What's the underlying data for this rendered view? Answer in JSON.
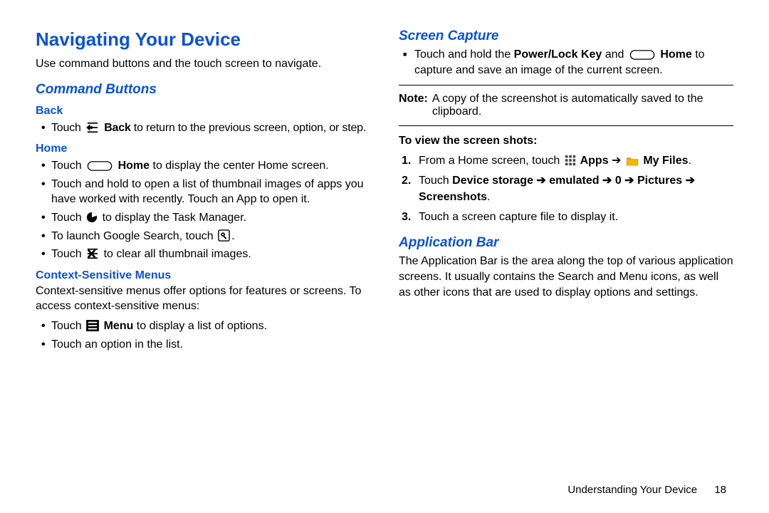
{
  "left": {
    "h1": "Navigating Your Device",
    "intro": "Use command buttons and the touch screen to navigate.",
    "h2_cmd": "Command Buttons",
    "back": {
      "h3": "Back",
      "b1a": "Touch ",
      "b1b": " Back",
      "b1c": " to return to the previous screen, option, or step."
    },
    "home": {
      "h3": "Home",
      "b1a": "Touch ",
      "b1b": " Home",
      "b1c": " to display the center Home screen.",
      "b2": "Touch and hold to open a list of thumbnail images of apps you have worked with recently. Touch an App to open it.",
      "b3a": "Touch ",
      "b3b": " to display the Task Manager.",
      "b4a": "To launch Google Search, touch ",
      "b4b": ".",
      "b5a": "Touch ",
      "b5b": " to clear all thumbnail images."
    },
    "csm": {
      "h3": "Context-Sensitive Menus",
      "p": "Context-sensitive menus offer options for features or screens. To access context-sensitive menus:",
      "b1a": "Touch ",
      "b1b": " Menu",
      "b1c": " to display a list of options.",
      "b2": "Touch an option in the list."
    }
  },
  "right": {
    "h2_sc": "Screen Capture",
    "sc_b1a": "Touch and hold the ",
    "sc_b1b": "Power/Lock Key",
    "sc_b1c": " and ",
    "sc_b1d": " Home",
    "sc_b1e": " to capture and save an image of the current screen.",
    "note_lbl": "Note:",
    "note_txt": "A copy of the screenshot is automatically saved to the clipboard.",
    "view_h": "To view the screen shots:",
    "s1a": "From a Home screen, touch ",
    "s1b": " Apps",
    "s1c": " ➔ ",
    "s1d": " My Files",
    "s1e": ".",
    "s2a": "Touch ",
    "s2b": "Device storage ➔ emulated ➔ 0 ➔ Pictures ➔ Screenshots",
    "s2c": ".",
    "s3": "Touch a screen capture file to display it.",
    "h2_ab": "Application Bar",
    "ab_p": "The Application Bar is the area along the top of various application screens. It usually contains the Search and Menu icons, as well as other icons that are used to display options and settings."
  },
  "footer": {
    "section": "Understanding Your Device",
    "page": "18"
  }
}
